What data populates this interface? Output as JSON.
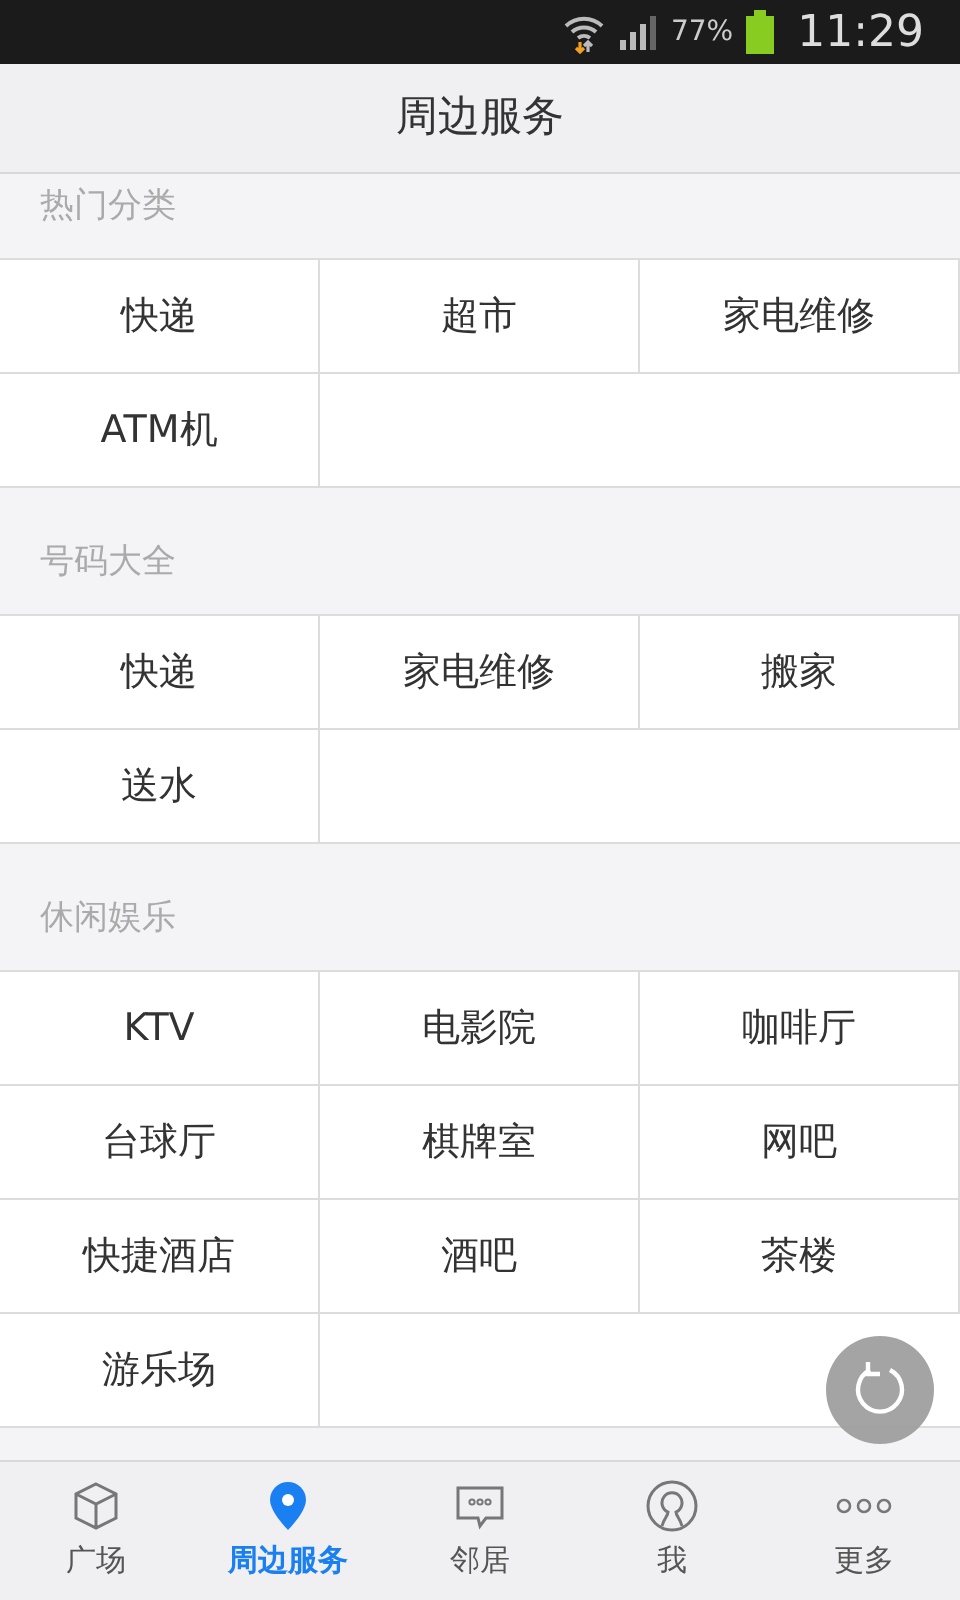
{
  "status_bar": {
    "battery": "77%",
    "time": "11:29"
  },
  "title": "周边服务",
  "sections": [
    {
      "title": "热门分类",
      "items": [
        "快递",
        "超市",
        "家电维修",
        "ATM机"
      ]
    },
    {
      "title": "号码大全",
      "items": [
        "快递",
        "家电维修",
        "搬家",
        "送水"
      ]
    },
    {
      "title": "休闲娱乐",
      "items": [
        "KTV",
        "电影院",
        "咖啡厅",
        "台球厅",
        "棋牌室",
        "网吧",
        "快捷酒店",
        "酒吧",
        "茶楼",
        "游乐场"
      ]
    }
  ],
  "nav": [
    {
      "label": "广场",
      "selected": false
    },
    {
      "label": "周边服务",
      "selected": true
    },
    {
      "label": "邻居",
      "selected": false
    },
    {
      "label": "我",
      "selected": false
    },
    {
      "label": "更多",
      "selected": false
    }
  ]
}
